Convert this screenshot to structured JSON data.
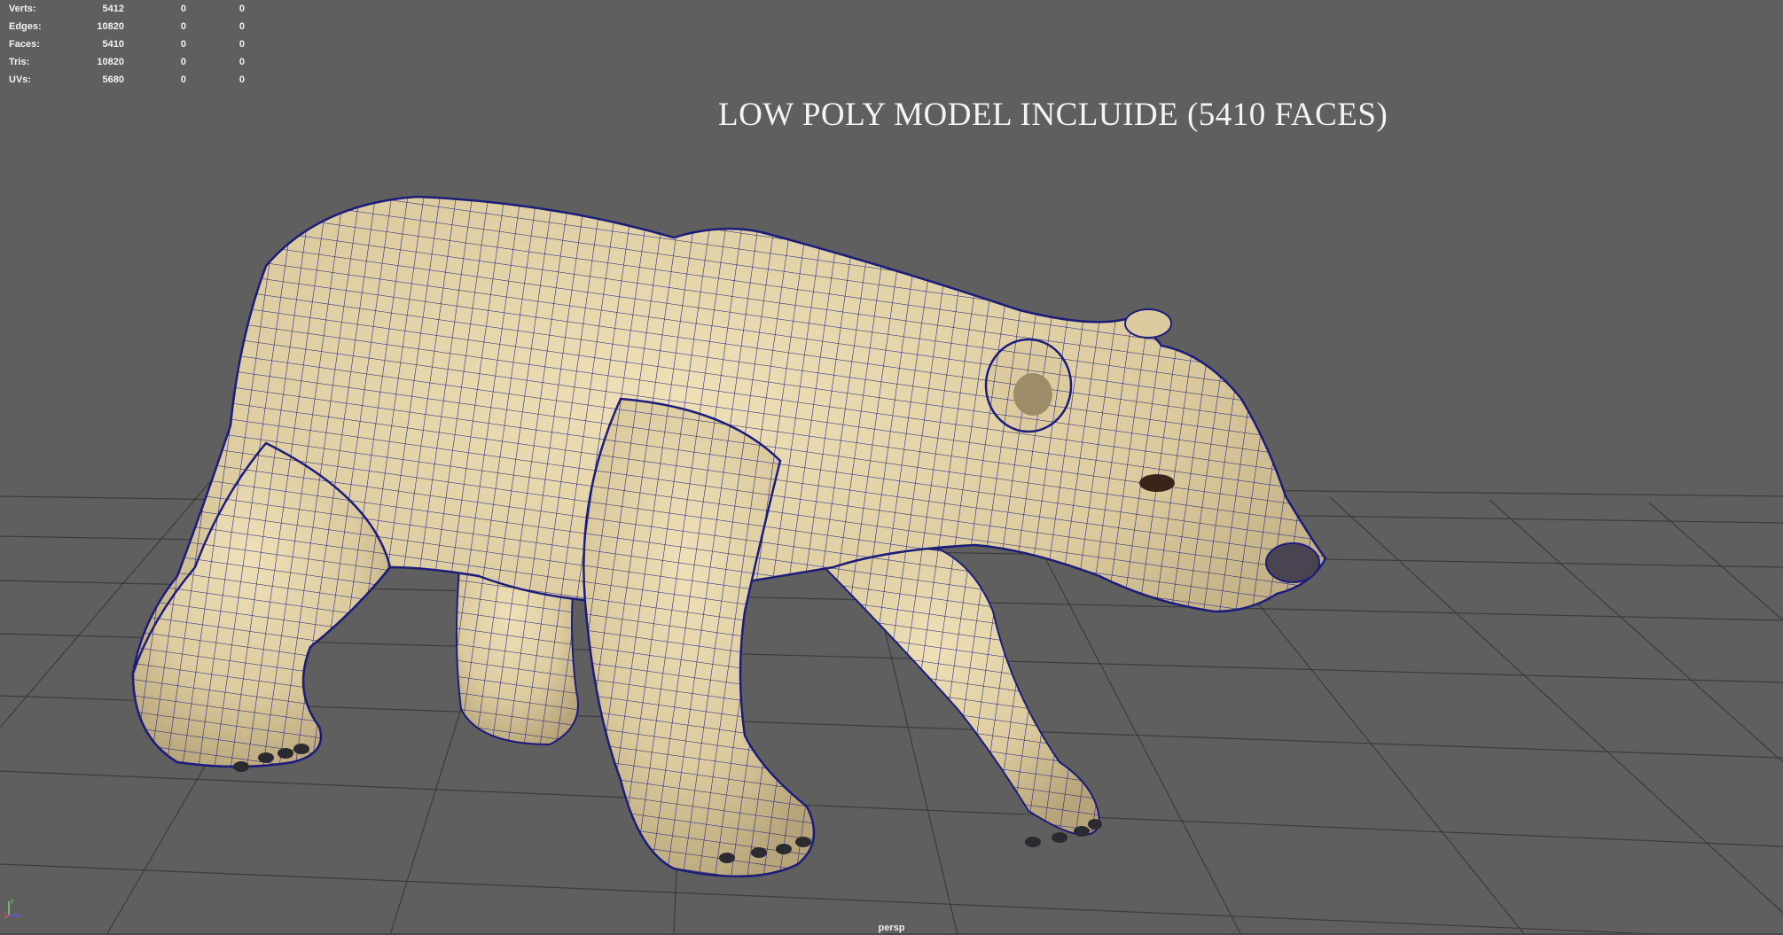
{
  "hud": {
    "rows": [
      {
        "label": "Verts:",
        "v1": "5412",
        "v2": "0",
        "v3": "0"
      },
      {
        "label": "Edges:",
        "v1": "10820",
        "v2": "0",
        "v3": "0"
      },
      {
        "label": "Faces:",
        "v1": "5410",
        "v2": "0",
        "v3": "0"
      },
      {
        "label": "Tris:",
        "v1": "10820",
        "v2": "0",
        "v3": "0"
      },
      {
        "label": "UVs:",
        "v1": "5680",
        "v2": "0",
        "v3": "0"
      }
    ]
  },
  "overlay": {
    "title": "LOW POLY MODEL INCLUIDE (5410 FACES)"
  },
  "viewport": {
    "camera": "persp",
    "background_color": "#5f5f5f",
    "grid_color": "#3a3a3a",
    "model_fill_color": "#e2d2a8",
    "wireframe_color": "#1c1c7a",
    "model": "polar-bear"
  },
  "axes": {
    "x": "x",
    "y": "y"
  }
}
